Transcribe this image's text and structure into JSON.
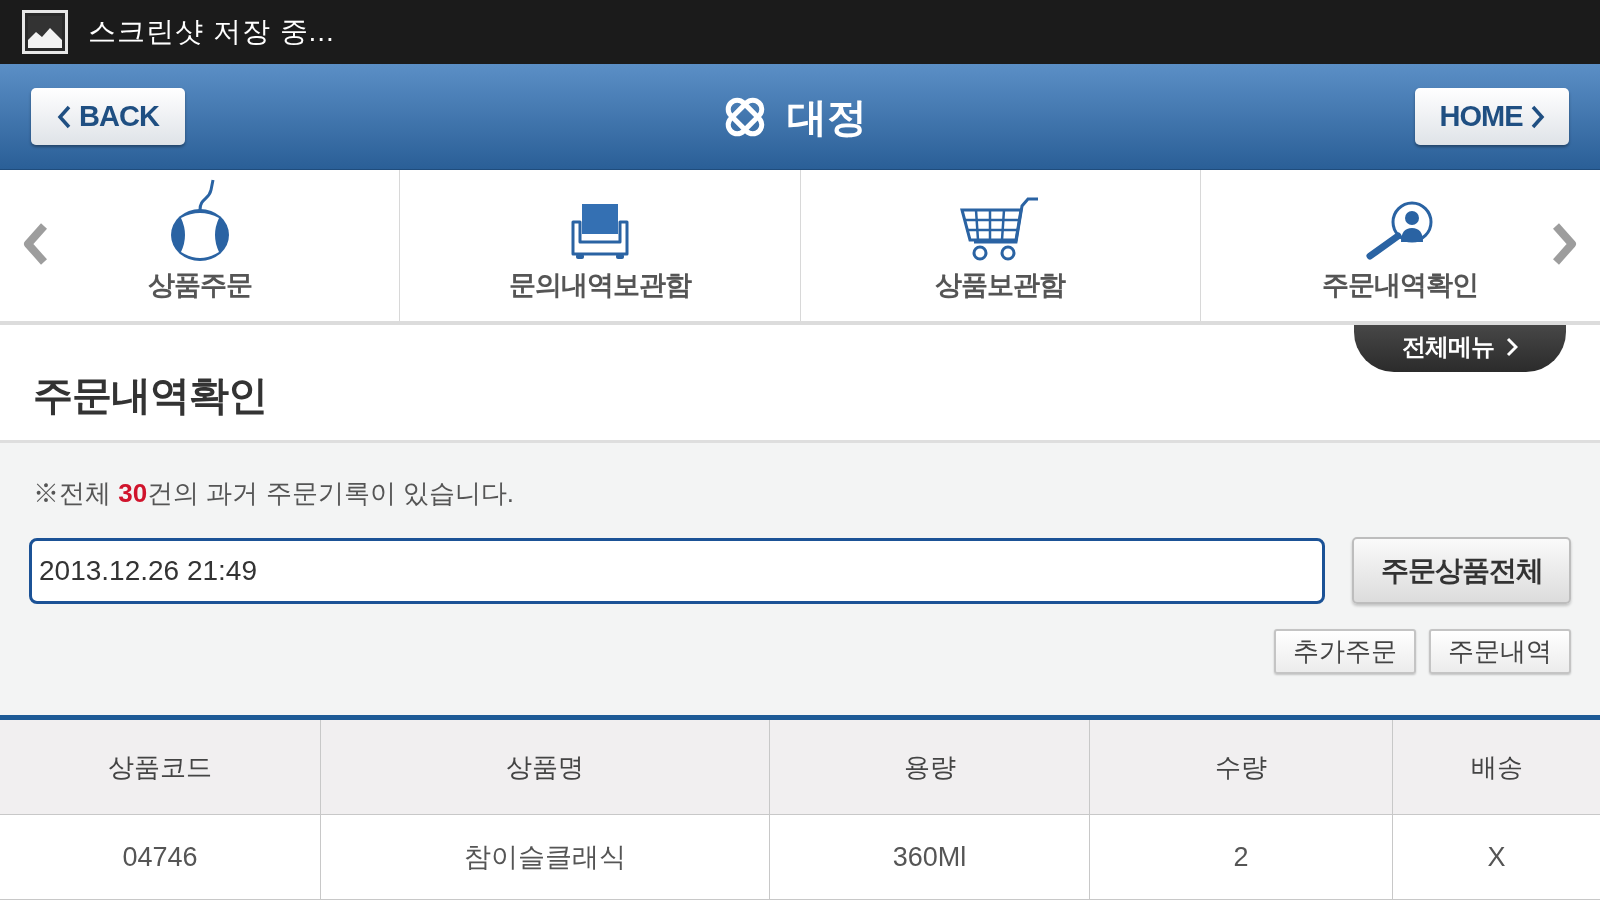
{
  "status_bar": {
    "text": "스크린샷 저장 중..."
  },
  "header": {
    "back_button": "BACK",
    "logo_text": "대정",
    "home_button": "HOME"
  },
  "menu": {
    "items": [
      "상품주문",
      "문의내역보관함",
      "상품보관함",
      "주문내역확인"
    ],
    "all_menu_tab": "전체메뉴"
  },
  "page_title": "주문내역확인",
  "notice": "※전체 **30**건의 과거 주문기록이 있습니다.",
  "order_field": {
    "value": "2013.12.26 21:49"
  },
  "all_items_button": "주문상품전체",
  "action_buttons": [
    "추가주문",
    "주문내역"
  ],
  "table": {
    "columns": [
      "상품코드",
      "상품명",
      "용량",
      "수량",
      "배송"
    ],
    "rows": [
      [
        "04746",
        "참이슬클래식",
        "360Ml",
        "2",
        "X"
      ]
    ]
  }
}
